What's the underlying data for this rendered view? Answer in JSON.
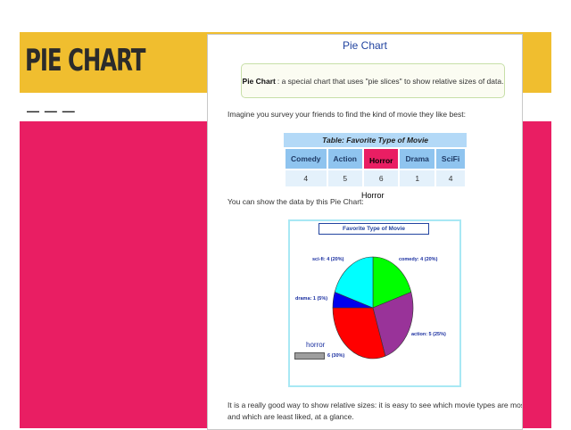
{
  "slide": {
    "title": "PIE CHART",
    "dashes": "— — —",
    "colors": {
      "top_band": "#f0be2f",
      "main_band": "#e91e63"
    }
  },
  "screenshot": {
    "page_title": "Pie Chart",
    "definition": {
      "term": "Pie Chart",
      "text": ": a special chart that uses \"pie slices\" to show relative sizes of data."
    },
    "intro": "Imagine you survey your friends to find the kind of movie they like best:",
    "table": {
      "caption": "Table: Favorite Type of Movie",
      "headers": [
        "Comedy",
        "Action",
        "Horror",
        "Drama",
        "SciFi"
      ],
      "values": [
        "4",
        "5",
        "6",
        "1",
        "4"
      ]
    },
    "highlight_label": "Horror",
    "show_text": "You can show the data by this Pie Chart:",
    "outro_line1": "It is a really good way to show relative sizes: it is easy to see which movie types are most liked,",
    "outro_line2": "and which are least liked, at a glance."
  },
  "chart_data": {
    "type": "pie",
    "title": "Favorite Type of Movie",
    "slices": [
      {
        "label": "comedy: 4  (20%)",
        "value": 4,
        "color": "#00ff00"
      },
      {
        "label": "action: 5  (25%)",
        "value": 5,
        "color": "#993399"
      },
      {
        "label": "6  (30%)",
        "value": 6,
        "color": "#ff0000"
      },
      {
        "label": "drama: 1  (5%)",
        "value": 1,
        "color": "#0000ee"
      },
      {
        "label": "sci-fi: 4  (20%)",
        "value": 4,
        "color": "#00ffff"
      }
    ],
    "legend_text": "horror"
  }
}
